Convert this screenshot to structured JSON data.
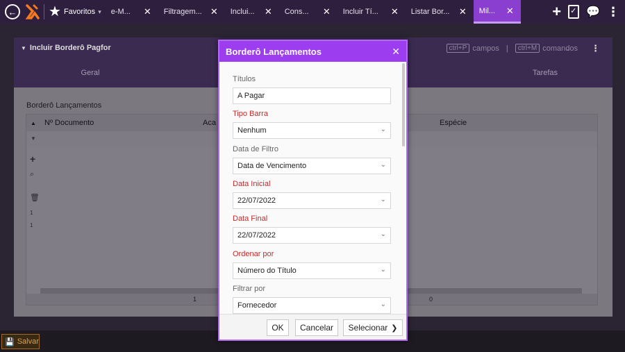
{
  "topbar": {
    "favorites_label": "Favoritos",
    "tabs": [
      {
        "label": "e-M..."
      },
      {
        "label": "Filtragem..."
      },
      {
        "label": "Inclui..."
      },
      {
        "label": "Cons..."
      },
      {
        "label": "Incluir Tí..."
      },
      {
        "label": "Listar Bor..."
      },
      {
        "label": "Mil..."
      }
    ],
    "active_tab_index": 6,
    "close_glyph": "✕"
  },
  "window": {
    "title": "Incluir Borderô Pagfor",
    "shortcut_fields_key": "ctrl+P",
    "shortcut_fields_label": "campos",
    "shortcut_commands_key": "ctrl+M",
    "shortcut_commands_label": "comandos",
    "tabs": [
      "Geral",
      "Tarefas"
    ],
    "section_title": "Borderô Lançamentos",
    "grid": {
      "columns": [
        "Nº Documento",
        "Aca",
        "Espécie"
      ],
      "row_numbers": [
        "1",
        "1"
      ],
      "footer_values": [
        "1",
        "0"
      ]
    }
  },
  "bottom": {
    "save_label": "Salvar"
  },
  "modal": {
    "title": "Borderô Lançamentos",
    "close_glyph": "✕",
    "fields": [
      {
        "label": "Títulos",
        "value": "A Pagar",
        "required": false,
        "dropdown": false
      },
      {
        "label": "Tipo Barra",
        "value": "Nenhum",
        "required": true,
        "dropdown": true
      },
      {
        "label": "Data de Filtro",
        "value": "Data de Vencimento",
        "required": false,
        "dropdown": true
      },
      {
        "label": "Data Inicial",
        "value": "22/07/2022",
        "required": true,
        "dropdown": true
      },
      {
        "label": "Data Final",
        "value": "22/07/2022",
        "required": true,
        "dropdown": true
      },
      {
        "label": "Ordenar por",
        "value": "Número do Título",
        "required": true,
        "dropdown": true
      },
      {
        "label": "Filtrar por",
        "value": "Fornecedor",
        "required": false,
        "dropdown": true
      }
    ],
    "buttons": {
      "ok": "OK",
      "cancel": "Cancelar",
      "select": "Selecionar"
    }
  },
  "colors": {
    "accent": "#9c3df0",
    "required_label": "#c62828"
  }
}
